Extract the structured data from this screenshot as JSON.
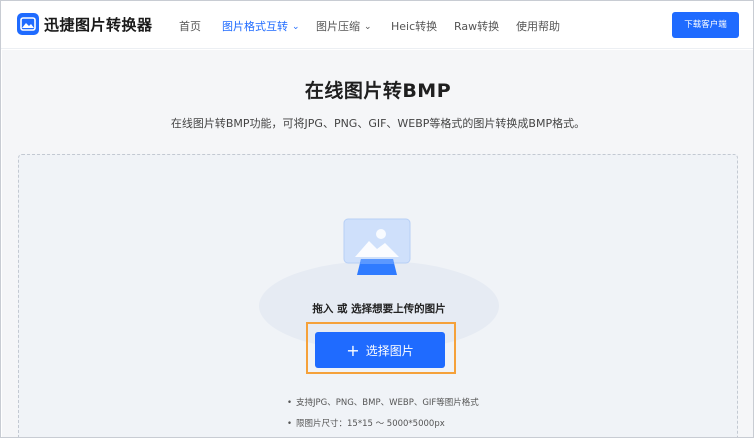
{
  "header": {
    "brand": "迅捷图片转换器",
    "nav": [
      {
        "label": "首页",
        "active": false,
        "dropdown": false
      },
      {
        "label": "图片格式互转",
        "active": true,
        "dropdown": true
      },
      {
        "label": "图片压缩",
        "active": false,
        "dropdown": true
      },
      {
        "label": "Heic转换",
        "active": false,
        "dropdown": false
      },
      {
        "label": "Raw转换",
        "active": false,
        "dropdown": false
      },
      {
        "label": "使用帮助",
        "active": false,
        "dropdown": false
      }
    ],
    "download_label": "下载客户端"
  },
  "main": {
    "title": "在线图片转BMP",
    "subtitle": "在线图片转BMP功能，可将JPG、PNG、GIF、WEBP等格式的图片转换成BMP格式。",
    "drop_text": "拖入 或 选择想要上传的图片",
    "select_button": "选择图片",
    "notes": [
      "支持JPG、PNG、BMP、WEBP、GIF等图片格式",
      "限图片尺寸：15*15 ～ 5000*5000px"
    ]
  },
  "colors": {
    "accent": "#1f6bff",
    "highlight": "#f5a13a"
  },
  "icons": {
    "logo": "image-logo-icon",
    "chevron": "chevron-down-icon",
    "plus": "plus-icon",
    "upload": "image-upload-illustration"
  }
}
